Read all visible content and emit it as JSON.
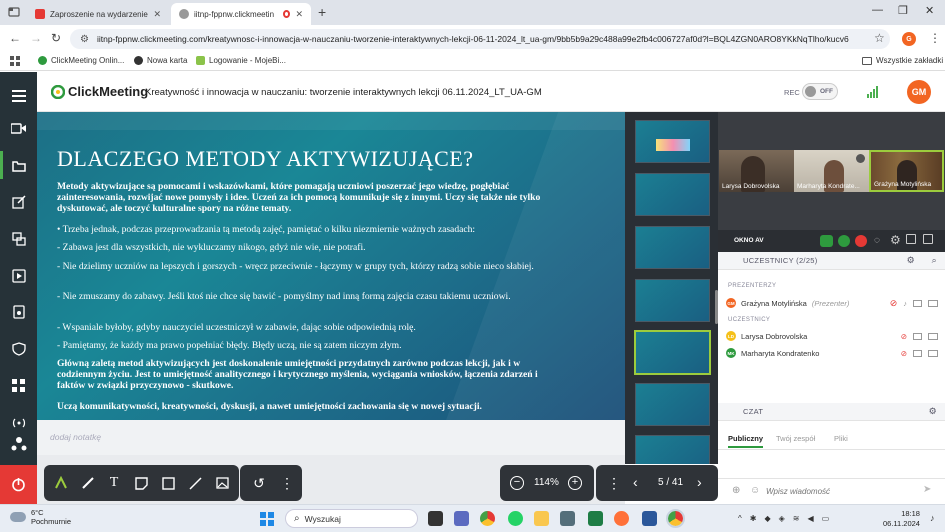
{
  "browser": {
    "tabs": [
      {
        "title": "Zaproszenie na wydarzenie \"Kre",
        "favicon_color": "#e53935"
      },
      {
        "title": "iitnp-fppnw.clickmeeting.com",
        "favicon_color": "#888888"
      }
    ],
    "url": "iitnp-fppnw.clickmeeting.com/kreatywnosc-i-innowacja-w-nauczaniu-tworzenie-interaktywnych-lekcji-06-11-2024_lt_ua-gm/9bb5b9a29c488a99e2fb4c006727af0d?l=BQL4ZGN0ARO8YKkNqTlho/kucv6",
    "profile_initial": "G",
    "bookmarks": [
      "ClickMeeting Onlin...",
      "Nowa karta",
      "Logowanie - MojeBi..."
    ],
    "all_bookmarks": "Wszystkie zakładki"
  },
  "app": {
    "logo": "ClickMeeting",
    "event_title": "Kreatywność i innowacja w nauczaniu: tworzenie interaktywnych lekcji 06.11.2024_LT_UA-GM",
    "rec_label": "REC",
    "rec_toggle": "OFF",
    "user_initials": "GM",
    "accent_color": "#f26522"
  },
  "slide": {
    "title": "DLACZEGO METODY AKTYWIZUJĄCE?",
    "lines": [
      {
        "text": "Metody aktywizujące są  pomocami i wskazówkami, które pomagają uczniowi poszerzać jego wiedzę, pogłębiać zainteresowania, rozwijać nowe pomysły i idee. Uczeń za ich pomocą komunikuje się z innymi. Uczy się także nie tylko dyskutować, ale toczyć kulturalne spory na różne tematy.",
        "bold": true
      },
      {
        "text": "•    Trzeba jednak, podczas przeprowadzania tą metodą zajęć, pamiętać o kilku niezmiernie ważnych zasadach:",
        "bold": false
      },
      {
        "text": "- Zabawa jest dla wszystkich, nie wykluczamy nikogo, gdyż nie wie, nie potrafi.",
        "bold": false
      },
      {
        "text": "- Nie dzielimy uczniów na lepszych i gorszych - wręcz przeciwnie - łączymy w grupy tych, którzy radzą sobie nieco słabiej.",
        "bold": false
      },
      {
        "text": "- Nie zmuszamy do zabawy. Jeśli ktoś nie chce się bawić - pomyślmy nad inną formą zajęcia czasu takiemu uczniowi.",
        "bold": false
      },
      {
        "text": "- Wspaniale byłoby, gdyby nauczyciel uczestniczył w zabawie, dając sobie odpowiednią rolę.",
        "bold": false
      },
      {
        "text": "- Pamiętamy, że każdy ma prawo popełniać błędy. Błędy uczą, nie są zatem niczym złym.",
        "bold": false
      },
      {
        "text": "Główną zaletą metod aktywizujących jest doskonalenie umiejętności przydatnych zarówno podczas lekcji, jak i w codziennym życiu. Jest to umiejętność analitycznego i krytycznego myślenia, wyciągania wniosków, łączenia zdarzeń i faktów w związki przyczynowo - skutkowe.",
        "bold": true
      },
      {
        "text": "Uczą komunikatywności, kreatywności, dyskusji, a nawet umiejętności zachowania się w nowej sytuacji.",
        "bold": true
      }
    ],
    "notes_placeholder": "dodaj notatkę"
  },
  "presentation": {
    "zoom": "114%",
    "page": "5 / 41"
  },
  "videos": [
    {
      "name": "Larysa Dobrovolska"
    },
    {
      "name": "Marharyta Kondrate..."
    },
    {
      "name": "Grażyna Motylińska"
    }
  ],
  "panel": {
    "video_window_label": "OKNO AV",
    "participants_header": "UCZESTNICY (2/25)",
    "presenters_group": "PREZENTERZY",
    "attendees_group": "UCZESTNICY",
    "presenters": [
      {
        "name": "Grażyna Motylińska",
        "role": "(Prezenter)",
        "initials": "GM",
        "color": "#f26522"
      }
    ],
    "attendees": [
      {
        "name": "Larysa Dobrovolska",
        "initials": "LD",
        "color": "#f5c01a"
      },
      {
        "name": "Marharyta Kondratenko",
        "initials": "MK",
        "color": "#2e9a3e"
      }
    ],
    "chat_header": "CZAT",
    "chat_tabs": [
      "Publiczny",
      "Twój zespół",
      "Pliki"
    ],
    "chat_placeholder": "Wpisz wiadomość"
  },
  "taskbar": {
    "temperature": "6°C",
    "weather": "Pochmurnie",
    "search_placeholder": "Wyszukaj",
    "time": "18:18",
    "date": "06.11.2024"
  }
}
